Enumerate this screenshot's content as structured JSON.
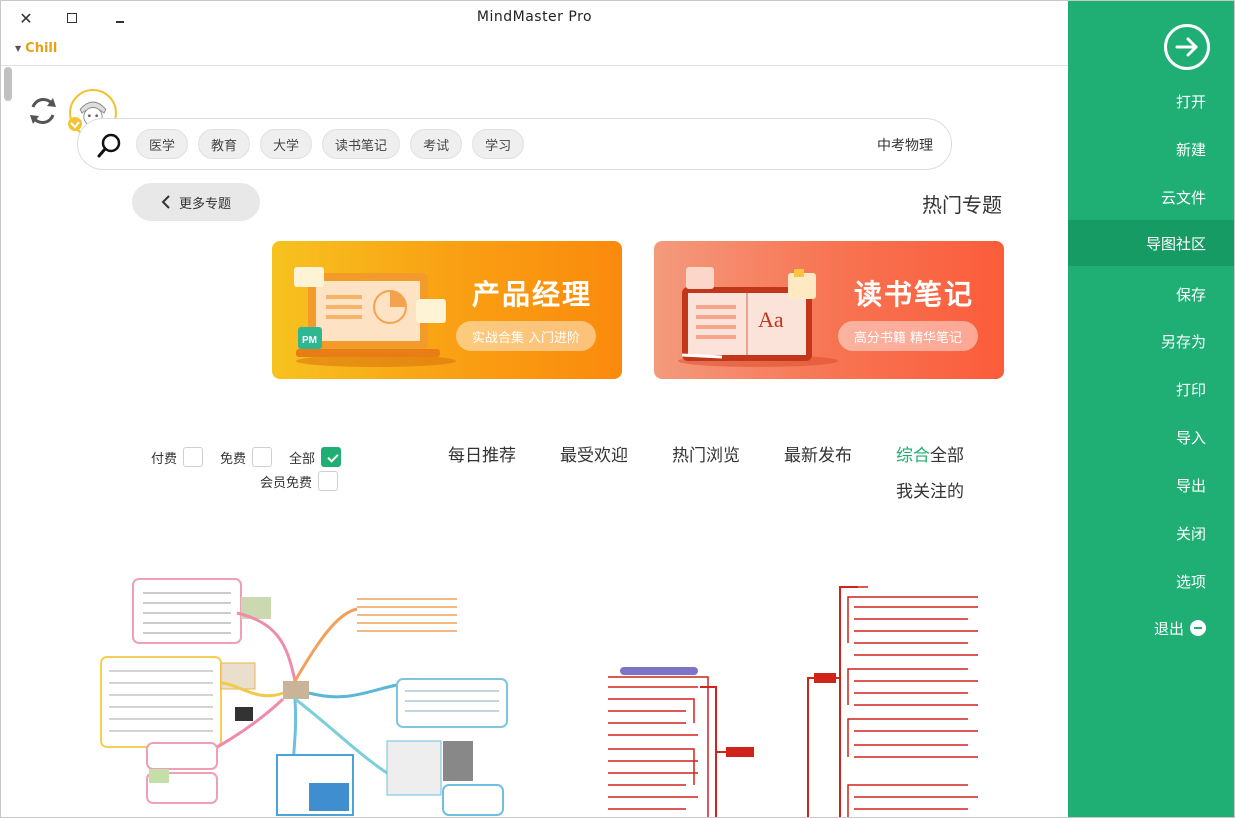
{
  "window": {
    "title": "MindMaster Pro",
    "user_name": "Chill"
  },
  "sidebar": {
    "back_icon": "arrow-right-circle-icon",
    "items": [
      {
        "label": "打开"
      },
      {
        "label": "新建"
      },
      {
        "label": "云文件"
      },
      {
        "label": "导图社区",
        "active": true
      },
      {
        "label": "保存"
      },
      {
        "label": "另存为"
      },
      {
        "label": "打印"
      },
      {
        "label": "导入"
      },
      {
        "label": "导出"
      },
      {
        "label": "关闭"
      },
      {
        "label": "选项"
      },
      {
        "label": "退出"
      }
    ],
    "color": "#1fae73"
  },
  "search": {
    "value": "中考物理",
    "tags": [
      "学习",
      "考试",
      "读书笔记",
      "大学",
      "教育",
      "医学"
    ]
  },
  "hot": {
    "title": "热门专题",
    "more_label": "更多专题",
    "banners": [
      {
        "title": "读书笔记",
        "subtitle": "高分书籍 精华笔记",
        "art_text": "Aa"
      },
      {
        "title": "产品经理",
        "subtitle": "实战合集 入门进阶",
        "art_text": "PM"
      }
    ]
  },
  "tabs": {
    "items": [
      "全部",
      "综合",
      "最新发布",
      "热门浏览",
      "最受欢迎",
      "每日推荐"
    ],
    "second_row": "我关注的",
    "active": "综合",
    "accent": "#1fae73"
  },
  "filters": {
    "all": "全部",
    "free": "免费",
    "paid": "付费",
    "member_free": "会员免费"
  }
}
